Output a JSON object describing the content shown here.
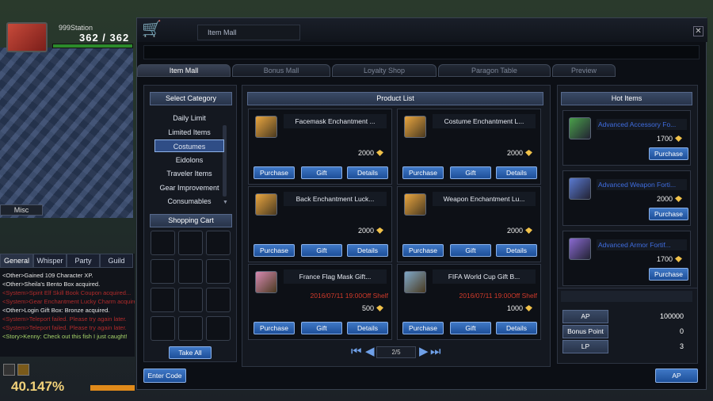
{
  "game": {
    "player_name": "999Station",
    "hp": "362 / 362",
    "misc_label": "Misc",
    "level_percent": "40.147%",
    "chat_tabs": [
      "General",
      "Whisper",
      "Party",
      "Guild"
    ],
    "chat_lines": [
      {
        "text": "<Other>Gained 109 Character XP.",
        "color": "white"
      },
      {
        "text": "<Other>Sheila's Bento Box acquired.",
        "color": "white"
      },
      {
        "text": "<System>Spirit Elf Skill Book Coupon acquired...",
        "color": "red"
      },
      {
        "text": "<System>Gear Enchantment Lucky Charm acquired",
        "color": "red"
      },
      {
        "text": "<Other>Login Gift Box: Bronze acquired.",
        "color": "white"
      },
      {
        "text": "<System>Teleport failed. Please try again later.",
        "color": "red"
      },
      {
        "text": "<System>Teleport failed. Please try again later.",
        "color": "red"
      },
      {
        "text": "<Story>Kenny: Check out this fish I just caught!",
        "color": "green"
      }
    ]
  },
  "window": {
    "title": "Item Mall",
    "close_label": "✕",
    "tabs": [
      {
        "label": "Item Mall",
        "active": true
      },
      {
        "label": "Bonus Mall",
        "active": false
      },
      {
        "label": "Loyalty Shop",
        "active": false
      },
      {
        "label": "Paragon Table",
        "active": false
      },
      {
        "label": "Preview",
        "active": false
      }
    ]
  },
  "category": {
    "header": "Select Category",
    "items": [
      "Daily Limit",
      "Limited Items",
      "Costumes",
      "Eidolons",
      "Traveler Items",
      "Gear Improvement",
      "Consumables"
    ],
    "selected": "Costumes"
  },
  "cart": {
    "header": "Shopping Cart",
    "take_all": "Take All"
  },
  "enter_code": "Enter Code",
  "products": {
    "header": "Product List",
    "items": [
      {
        "name": "Facemask Enchantment ...",
        "price": "2000",
        "date": "",
        "color": "#e9a640"
      },
      {
        "name": "Costume Enchantment L...",
        "price": "2000",
        "date": "",
        "color": "#e9a640"
      },
      {
        "name": "Back Enchantment Luck...",
        "price": "2000",
        "date": "",
        "color": "#e9a640"
      },
      {
        "name": "Weapon Enchantment Lu...",
        "price": "2000",
        "date": "",
        "color": "#e9a640"
      },
      {
        "name": "France Flag Mask Gift...",
        "price": "500",
        "date": "2016/07/11 19:00Off Shelf",
        "color": "#d78ab2"
      },
      {
        "name": "FIFA World Cup Gift B...",
        "price": "1000",
        "date": "2016/07/11 19:00Off Shelf",
        "color": "#7fa8c8"
      }
    ],
    "purchase_label": "Purchase",
    "gift_label": "Gift",
    "details_label": "Details",
    "page": "2/5"
  },
  "hot": {
    "header": "Hot Items",
    "items": [
      {
        "name": "Advanced Accessory Fo...",
        "price": "1700",
        "color": "#4aa04a"
      },
      {
        "name": "Advanced Weapon Forti...",
        "price": "2000",
        "color": "#5a7ad0"
      },
      {
        "name": "Advanced Armor Fortif...",
        "price": "1700",
        "color": "#8a6ad0"
      }
    ],
    "purchase_label": "Purchase"
  },
  "currency": {
    "rows": [
      {
        "label": "AP",
        "value": "100000"
      },
      {
        "label": "Bonus Point",
        "value": "0"
      },
      {
        "label": "LP",
        "value": "3"
      }
    ],
    "ap_button": "AP"
  }
}
